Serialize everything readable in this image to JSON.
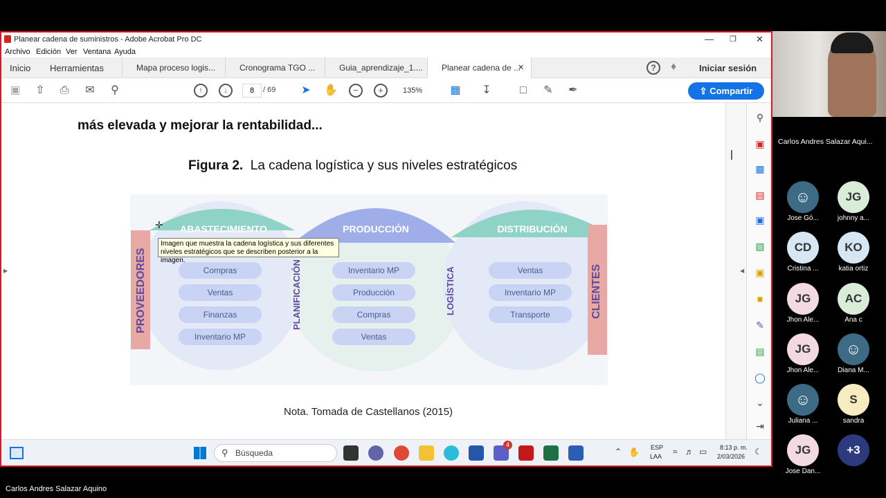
{
  "window": {
    "title": "Planear cadena de suministros - Adobe Acrobat Pro DC"
  },
  "menu": [
    "Archivo",
    "Edición",
    "Ver",
    "Ventana",
    "Ayuda"
  ],
  "tabs": {
    "home": "Inicio",
    "tools": "Herramientas",
    "docs": [
      "Mapa proceso logis...",
      "Cronograma TGO ...",
      "Guia_aprendizaje_1....",
      "Planear cadena de ..."
    ],
    "signin": "Iniciar sesión"
  },
  "toolbar": {
    "page": "8",
    "pages": "/ 69",
    "zoom": "135%",
    "share": "Compartir"
  },
  "document": {
    "text_top": "más elevada y mejorar la rentabilidad...",
    "figure_label": "Figura 2.",
    "figure_title": "La cadena logística y sus niveles estratégicos",
    "note": "Nota. Tomada de Castellanos (2015)"
  },
  "figure": {
    "headers": [
      "ABASTECIMIENTO",
      "PRODUCCIÓN",
      "DISTRIBUCIÓN"
    ],
    "side_left": "PROVEEDORES",
    "side_right": "CLIENTES",
    "mid1": "PLANIFICACIÓN",
    "mid2": "LOGÍSTICA",
    "col1": [
      "Compras",
      "Ventas",
      "Finanzas",
      "Inventario MP"
    ],
    "col2": [
      "Inventario MP",
      "Producción",
      "Compras",
      "Ventas"
    ],
    "col3": [
      "Ventas",
      "Inventario MP",
      "Transporte"
    ]
  },
  "tooltip": "Imagen que muestra la cadena logística y sus diferentes niveles estratégicos que se describen posterior a la imagen.",
  "taskbar": {
    "search": "Búsqueda",
    "lang1": "ESP",
    "lang2": "LAA",
    "time": "8:13 p. m.",
    "date": "2/03/2026",
    "teams_badge": "4"
  },
  "meeting": {
    "presenter": "Carlos Andres Salazar Aqui...",
    "bottom_name": "Carlos Andres Salazar Aquino",
    "participants": [
      {
        "init": "",
        "name": "Jose Gó...",
        "color": "#3d6b85"
      },
      {
        "init": "JG",
        "name": "johnny a...",
        "color": "#d8ecd8"
      },
      {
        "init": "CD",
        "name": "Cristina ...",
        "color": "#d7e6f3"
      },
      {
        "init": "KO",
        "name": "katia ortiz",
        "color": "#d7e6f3"
      },
      {
        "init": "JG",
        "name": "Jhon Ale...",
        "color": "#f3d9e1"
      },
      {
        "init": "AC",
        "name": "Ana c",
        "color": "#d8ecd8"
      },
      {
        "init": "JG",
        "name": "Jhon Ale...",
        "color": "#f3d9e1"
      },
      {
        "init": "",
        "name": "Diana M...",
        "color": "#3d6b85"
      },
      {
        "init": "",
        "name": "Juliana ...",
        "color": "#3d6b85"
      },
      {
        "init": "S",
        "name": "sandra",
        "color": "#f7ecc0"
      },
      {
        "init": "JG",
        "name": "Jose Dan...",
        "color": "#f3d9e1"
      },
      {
        "init": "+3",
        "name": "",
        "color": "#2d3a7d"
      }
    ]
  }
}
